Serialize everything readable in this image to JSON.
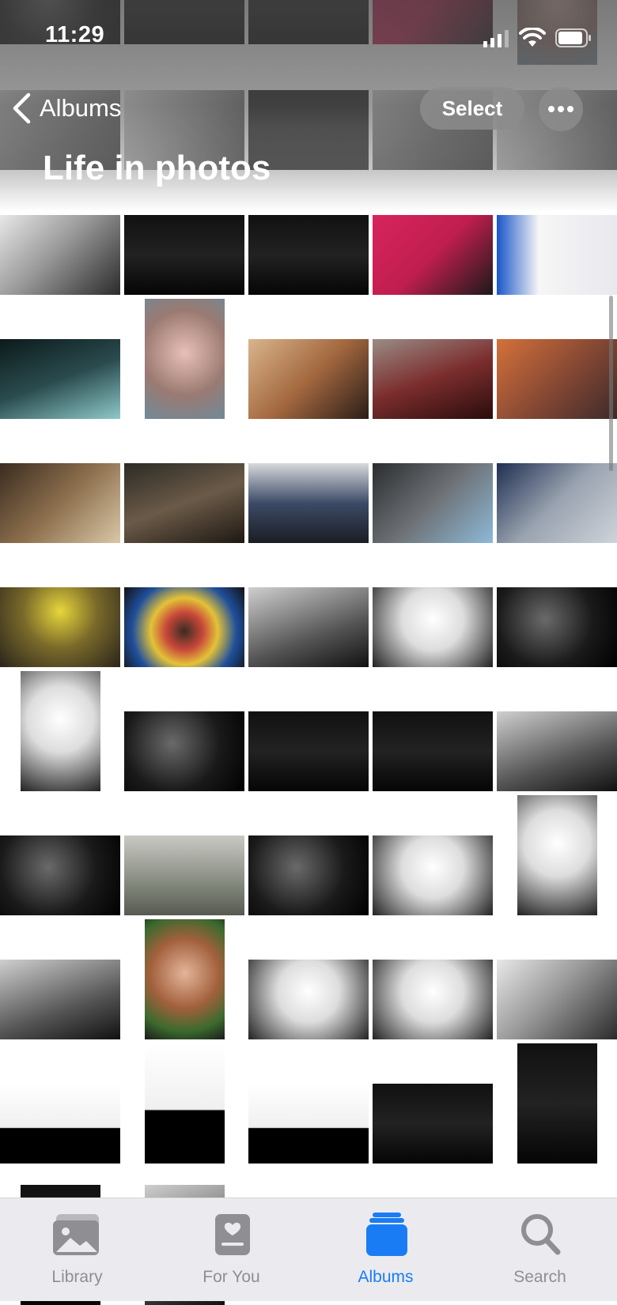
{
  "status_bar": {
    "time": "11:29"
  },
  "header": {
    "back_label": "Albums",
    "select_label": "Select",
    "title": "Life in photos"
  },
  "photos": [
    {
      "tone": "t-mono-light",
      "o": "land"
    },
    {
      "tone": "t-night",
      "o": "land"
    },
    {
      "tone": "t-night",
      "o": "land"
    },
    {
      "tone": "t-pink",
      "o": "land"
    },
    {
      "tone": "t-blue",
      "o": "land"
    },
    {
      "tone": "t-teal",
      "o": "land"
    },
    {
      "tone": "t-face",
      "o": "port"
    },
    {
      "tone": "t-warm",
      "o": "land"
    },
    {
      "tone": "t-red",
      "o": "land"
    },
    {
      "tone": "t-orange",
      "o": "land"
    },
    {
      "tone": "t-cafe",
      "o": "land"
    },
    {
      "tone": "t-diner",
      "o": "land"
    },
    {
      "tone": "t-office",
      "o": "land"
    },
    {
      "tone": "t-suit",
      "o": "land"
    },
    {
      "tone": "t-train",
      "o": "land"
    },
    {
      "tone": "t-flower",
      "o": "land"
    },
    {
      "tone": "t-glass",
      "o": "land"
    },
    {
      "tone": "t-mono-mid",
      "o": "land"
    },
    {
      "tone": "t-hiKey",
      "o": "land"
    },
    {
      "tone": "t-mono-dark",
      "o": "land"
    },
    {
      "tone": "t-hiKey",
      "o": "port"
    },
    {
      "tone": "t-mono-dark",
      "o": "land"
    },
    {
      "tone": "t-night",
      "o": "land"
    },
    {
      "tone": "t-night",
      "o": "land"
    },
    {
      "tone": "t-mono-mid",
      "o": "land"
    },
    {
      "tone": "t-mono-dark",
      "o": "land"
    },
    {
      "tone": "t-field",
      "o": "land"
    },
    {
      "tone": "t-mono-dark",
      "o": "land"
    },
    {
      "tone": "t-hiKey",
      "o": "land"
    },
    {
      "tone": "t-hiKey",
      "o": "port"
    },
    {
      "tone": "t-mono-mid",
      "o": "land"
    },
    {
      "tone": "t-granny",
      "o": "port"
    },
    {
      "tone": "t-hiKey",
      "o": "land"
    },
    {
      "tone": "t-hiKey",
      "o": "land"
    },
    {
      "tone": "t-mono-light",
      "o": "land"
    },
    {
      "tone": "t-silhouette",
      "o": "land"
    },
    {
      "tone": "t-silhouette",
      "o": "port"
    },
    {
      "tone": "t-silhouette",
      "o": "land"
    },
    {
      "tone": "t-night",
      "o": "land"
    },
    {
      "tone": "t-night",
      "o": "port"
    }
  ],
  "tabs": [
    {
      "label": "Library",
      "icon": "photo-library-icon",
      "active": false
    },
    {
      "label": "For You",
      "icon": "for-you-icon",
      "active": false
    },
    {
      "label": "Albums",
      "icon": "albums-icon",
      "active": true
    },
    {
      "label": "Search",
      "icon": "search-icon",
      "active": false
    }
  ],
  "colors": {
    "accent": "#1a7cf5",
    "tab_inactive": "#8e8e93"
  }
}
